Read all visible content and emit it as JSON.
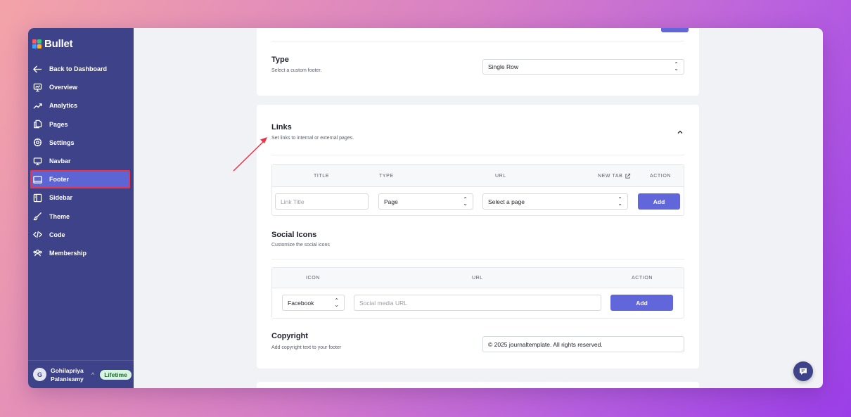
{
  "sidebar": {
    "brand": "Bullet",
    "nav": [
      {
        "label": "Back to Dashboard",
        "icon": "arrow-left-icon"
      },
      {
        "label": "Overview",
        "icon": "presentation-icon"
      },
      {
        "label": "Analytics",
        "icon": "trend-up-icon"
      },
      {
        "label": "Pages",
        "icon": "copy-pages-icon"
      },
      {
        "label": "Settings",
        "icon": "gear-icon"
      },
      {
        "label": "Navbar",
        "icon": "monitor-icon"
      },
      {
        "label": "Footer",
        "icon": "footer-layout-icon",
        "active": true
      },
      {
        "label": "Sidebar",
        "icon": "sidebar-layout-icon"
      },
      {
        "label": "Theme",
        "icon": "brush-icon"
      },
      {
        "label": "Code",
        "icon": "code-icon"
      },
      {
        "label": "Membership",
        "icon": "users-icon"
      }
    ],
    "user": {
      "initial": "G",
      "name": "Gohilapriya Palanisamy",
      "plan": "Lifetime"
    }
  },
  "type_section": {
    "title": "Type",
    "subtitle": "Select a custom footer.",
    "value": "Single Row"
  },
  "links_section": {
    "title": "Links",
    "subtitle": "Set links to internal or external pages.",
    "columns": {
      "title": "TITLE",
      "type": "TYPE",
      "url": "URL",
      "new_tab": "NEW TAB",
      "action": "ACTION"
    },
    "row": {
      "title_placeholder": "Link Title",
      "type_value": "Page",
      "url_value": "Select a page",
      "add_label": "Add"
    }
  },
  "social_section": {
    "title": "Social Icons",
    "subtitle": "Customize the social icons",
    "columns": {
      "icon": "ICON",
      "url": "URL",
      "action": "ACTION"
    },
    "row": {
      "icon_value": "Facebook",
      "url_placeholder": "Social media URL",
      "add_label": "Add"
    }
  },
  "copyright_section": {
    "title": "Copyright",
    "subtitle": "Add copyright text to your footer",
    "value": "© 2025 journaltemplate. All rights reserved."
  },
  "colors": {
    "sidebar_bg": "#3e4389",
    "accent": "#6266db",
    "highlight_border": "#e8334b",
    "annotation_arrow": "#e8334b"
  }
}
